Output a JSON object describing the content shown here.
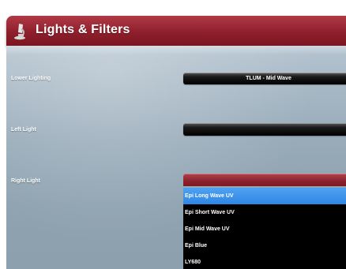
{
  "header": {
    "title": "Lights & Filters",
    "icon": "microscope-icon",
    "color": "#8f1f2c"
  },
  "rows": [
    {
      "label": "Lower Lighting",
      "value": "TLUM - Mid Wave"
    },
    {
      "label": "Left Light",
      "value": ""
    },
    {
      "label": "Right Light",
      "value": ""
    }
  ],
  "dropdown": {
    "options": [
      "Epi Long Wave UV",
      "Epi Short Wave UV",
      "Epi Mid Wave UV",
      "Epi Blue",
      "LY680"
    ],
    "selected_index": 0,
    "highlight_color": "#3a8ee8"
  }
}
